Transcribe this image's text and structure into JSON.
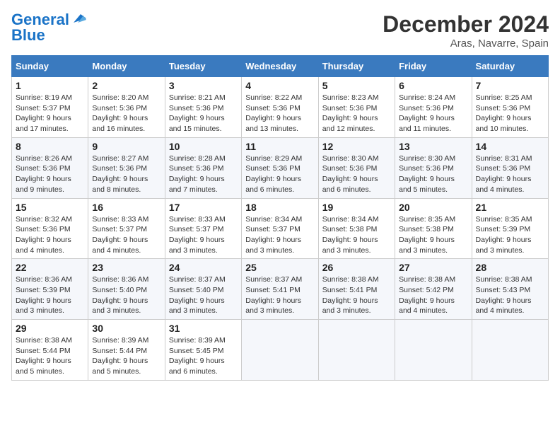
{
  "header": {
    "logo_line1": "General",
    "logo_line2": "Blue",
    "month": "December 2024",
    "location": "Aras, Navarre, Spain"
  },
  "columns": [
    "Sunday",
    "Monday",
    "Tuesday",
    "Wednesday",
    "Thursday",
    "Friday",
    "Saturday"
  ],
  "weeks": [
    [
      {
        "day": "1",
        "info": "Sunrise: 8:19 AM\nSunset: 5:37 PM\nDaylight: 9 hours\nand 17 minutes."
      },
      {
        "day": "2",
        "info": "Sunrise: 8:20 AM\nSunset: 5:36 PM\nDaylight: 9 hours\nand 16 minutes."
      },
      {
        "day": "3",
        "info": "Sunrise: 8:21 AM\nSunset: 5:36 PM\nDaylight: 9 hours\nand 15 minutes."
      },
      {
        "day": "4",
        "info": "Sunrise: 8:22 AM\nSunset: 5:36 PM\nDaylight: 9 hours\nand 13 minutes."
      },
      {
        "day": "5",
        "info": "Sunrise: 8:23 AM\nSunset: 5:36 PM\nDaylight: 9 hours\nand 12 minutes."
      },
      {
        "day": "6",
        "info": "Sunrise: 8:24 AM\nSunset: 5:36 PM\nDaylight: 9 hours\nand 11 minutes."
      },
      {
        "day": "7",
        "info": "Sunrise: 8:25 AM\nSunset: 5:36 PM\nDaylight: 9 hours\nand 10 minutes."
      }
    ],
    [
      {
        "day": "8",
        "info": "Sunrise: 8:26 AM\nSunset: 5:36 PM\nDaylight: 9 hours\nand 9 minutes."
      },
      {
        "day": "9",
        "info": "Sunrise: 8:27 AM\nSunset: 5:36 PM\nDaylight: 9 hours\nand 8 minutes."
      },
      {
        "day": "10",
        "info": "Sunrise: 8:28 AM\nSunset: 5:36 PM\nDaylight: 9 hours\nand 7 minutes."
      },
      {
        "day": "11",
        "info": "Sunrise: 8:29 AM\nSunset: 5:36 PM\nDaylight: 9 hours\nand 6 minutes."
      },
      {
        "day": "12",
        "info": "Sunrise: 8:30 AM\nSunset: 5:36 PM\nDaylight: 9 hours\nand 6 minutes."
      },
      {
        "day": "13",
        "info": "Sunrise: 8:30 AM\nSunset: 5:36 PM\nDaylight: 9 hours\nand 5 minutes."
      },
      {
        "day": "14",
        "info": "Sunrise: 8:31 AM\nSunset: 5:36 PM\nDaylight: 9 hours\nand 4 minutes."
      }
    ],
    [
      {
        "day": "15",
        "info": "Sunrise: 8:32 AM\nSunset: 5:36 PM\nDaylight: 9 hours\nand 4 minutes."
      },
      {
        "day": "16",
        "info": "Sunrise: 8:33 AM\nSunset: 5:37 PM\nDaylight: 9 hours\nand 4 minutes."
      },
      {
        "day": "17",
        "info": "Sunrise: 8:33 AM\nSunset: 5:37 PM\nDaylight: 9 hours\nand 3 minutes."
      },
      {
        "day": "18",
        "info": "Sunrise: 8:34 AM\nSunset: 5:37 PM\nDaylight: 9 hours\nand 3 minutes."
      },
      {
        "day": "19",
        "info": "Sunrise: 8:34 AM\nSunset: 5:38 PM\nDaylight: 9 hours\nand 3 minutes."
      },
      {
        "day": "20",
        "info": "Sunrise: 8:35 AM\nSunset: 5:38 PM\nDaylight: 9 hours\nand 3 minutes."
      },
      {
        "day": "21",
        "info": "Sunrise: 8:35 AM\nSunset: 5:39 PM\nDaylight: 9 hours\nand 3 minutes."
      }
    ],
    [
      {
        "day": "22",
        "info": "Sunrise: 8:36 AM\nSunset: 5:39 PM\nDaylight: 9 hours\nand 3 minutes."
      },
      {
        "day": "23",
        "info": "Sunrise: 8:36 AM\nSunset: 5:40 PM\nDaylight: 9 hours\nand 3 minutes."
      },
      {
        "day": "24",
        "info": "Sunrise: 8:37 AM\nSunset: 5:40 PM\nDaylight: 9 hours\nand 3 minutes."
      },
      {
        "day": "25",
        "info": "Sunrise: 8:37 AM\nSunset: 5:41 PM\nDaylight: 9 hours\nand 3 minutes."
      },
      {
        "day": "26",
        "info": "Sunrise: 8:38 AM\nSunset: 5:41 PM\nDaylight: 9 hours\nand 3 minutes."
      },
      {
        "day": "27",
        "info": "Sunrise: 8:38 AM\nSunset: 5:42 PM\nDaylight: 9 hours\nand 4 minutes."
      },
      {
        "day": "28",
        "info": "Sunrise: 8:38 AM\nSunset: 5:43 PM\nDaylight: 9 hours\nand 4 minutes."
      }
    ],
    [
      {
        "day": "29",
        "info": "Sunrise: 8:38 AM\nSunset: 5:44 PM\nDaylight: 9 hours\nand 5 minutes."
      },
      {
        "day": "30",
        "info": "Sunrise: 8:39 AM\nSunset: 5:44 PM\nDaylight: 9 hours\nand 5 minutes."
      },
      {
        "day": "31",
        "info": "Sunrise: 8:39 AM\nSunset: 5:45 PM\nDaylight: 9 hours\nand 6 minutes."
      },
      null,
      null,
      null,
      null
    ]
  ]
}
